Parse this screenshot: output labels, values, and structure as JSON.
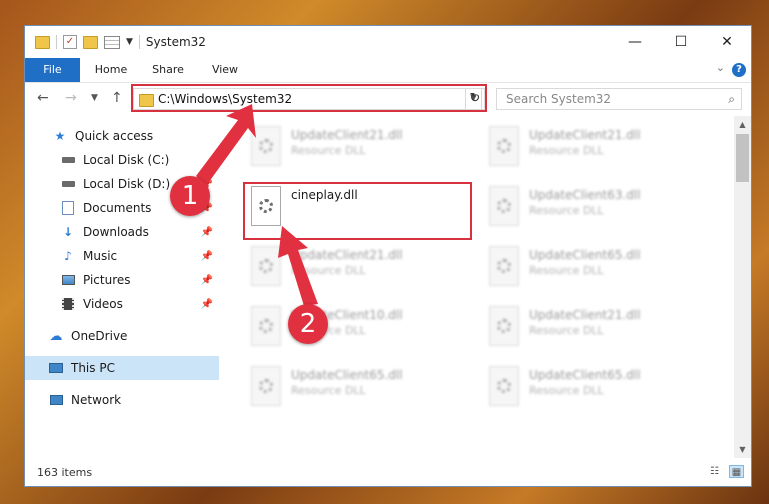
{
  "window": {
    "title": "System32"
  },
  "controls": {
    "minimize": "—",
    "maximize": "☐",
    "close": "✕"
  },
  "ribbon": {
    "tabs": [
      {
        "label": "File"
      },
      {
        "label": "Home"
      },
      {
        "label": "Share"
      },
      {
        "label": "View"
      }
    ],
    "help": "?"
  },
  "address": {
    "path": "C:\\Windows\\System32"
  },
  "search": {
    "placeholder": "Search System32"
  },
  "nav": {
    "items": [
      {
        "label": "Quick access",
        "icon": "star-icon"
      },
      {
        "label": "Local Disk (C:)",
        "icon": "drive-icon"
      },
      {
        "label": "Local Disk (D:)",
        "icon": "drive-icon"
      },
      {
        "label": "Documents",
        "icon": "documents-icon"
      },
      {
        "label": "Downloads",
        "icon": "download-icon"
      },
      {
        "label": "Music",
        "icon": "music-icon"
      },
      {
        "label": "Pictures",
        "icon": "pictures-icon"
      },
      {
        "label": "Videos",
        "icon": "videos-icon"
      },
      {
        "label": "OneDrive",
        "icon": "cloud-icon"
      },
      {
        "label": "This PC",
        "icon": "computer-icon"
      },
      {
        "label": "Network",
        "icon": "network-icon"
      }
    ]
  },
  "files": {
    "left": [
      {
        "name": "UpdateClient21.dll",
        "type": "Resource DLL"
      },
      {
        "name": "cineplay.dll",
        "type": ""
      },
      {
        "name": "UpdateClient21.dll",
        "type": "Resource DLL"
      },
      {
        "name": "UpdateClient10.dll",
        "type": "Resource DLL"
      },
      {
        "name": "UpdateClient65.dll",
        "type": "Resource DLL"
      }
    ],
    "right": [
      {
        "name": "UpdateClient21.dll",
        "type": "Resource DLL"
      },
      {
        "name": "UpdateClient63.dll",
        "type": "Resource DLL"
      },
      {
        "name": "UpdateClient65.dll",
        "type": "Resource DLL"
      },
      {
        "name": "UpdateClient21.dll",
        "type": "Resource DLL"
      },
      {
        "name": "UpdateClient65.dll",
        "type": "Resource DLL"
      }
    ]
  },
  "status": {
    "count": "163 items"
  },
  "callouts": {
    "one": "1",
    "two": "2"
  },
  "colors": {
    "accent": "#1f6fc7",
    "highlight": "#d7303f",
    "selected": "#cce4f7"
  }
}
